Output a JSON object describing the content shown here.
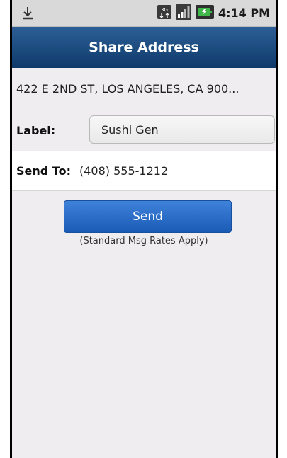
{
  "status_bar": {
    "left_icon": "download-icon",
    "network_icon": "3g-icon",
    "signal_icon": "signal-icon",
    "battery_icon": "battery-icon",
    "time": "4:14 PM"
  },
  "title_bar": {
    "title": "Share Address"
  },
  "address": {
    "text": "422 E 2ND ST, LOS ANGELES, CA 900..."
  },
  "label_field": {
    "label": "Label:",
    "value": "Sushi Gen"
  },
  "send_to": {
    "label": "Send To:",
    "value": "(408) 555-1212"
  },
  "actions": {
    "send_label": "Send",
    "note": "(Standard Msg Rates Apply)"
  },
  "colors": {
    "title_bar": "#1f4f86",
    "send_button": "#2a6cc8",
    "background": "#efedf0"
  }
}
